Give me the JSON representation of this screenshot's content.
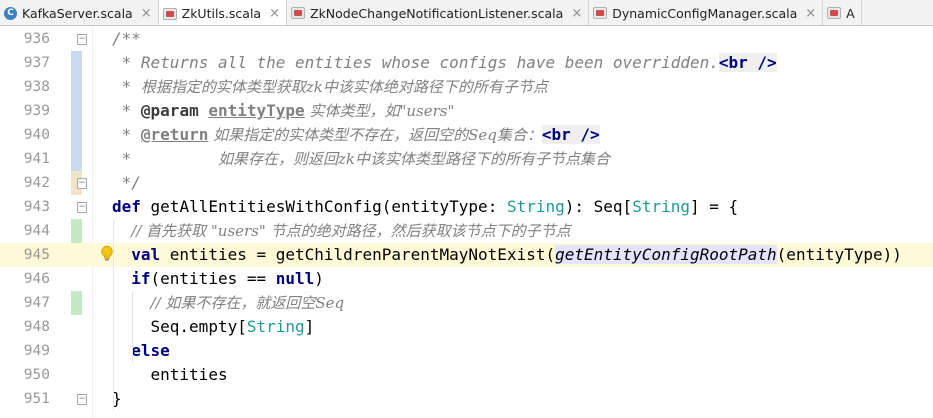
{
  "tabs": [
    {
      "label": "KafkaServer.scala",
      "icon": "class-icon",
      "icon_glyph": "C",
      "active": false
    },
    {
      "label": "ZkUtils.scala",
      "icon": "scala-file-icon",
      "icon_glyph": "",
      "active": true
    },
    {
      "label": "ZkNodeChangeNotificationListener.scala",
      "icon": "scala-file-icon",
      "icon_glyph": "",
      "active": false
    },
    {
      "label": "DynamicConfigManager.scala",
      "icon": "scala-file-icon",
      "icon_glyph": "",
      "active": false
    },
    {
      "label": "A",
      "icon": "scala-file-icon",
      "icon_glyph": "",
      "active": false
    }
  ],
  "close_glyph": "×",
  "line_numbers": [
    "936",
    "937",
    "938",
    "939",
    "940",
    "941",
    "942",
    "943",
    "944",
    "945",
    "946",
    "947",
    "948",
    "949",
    "950",
    "951"
  ],
  "code": {
    "l936": "/**",
    "l937_star": " * ",
    "l937_text": "Returns all the entities whose configs have been overridden.",
    "l937_tag": "<br />",
    "l938_star": " * ",
    "l938_text": "根据指定的实体类型获取zk中该实体绝对路径下的所有子节点",
    "l939_star": " * ",
    "l939_tag": "@param",
    "l939_param": "entityType",
    "l939_text": " 实体类型，如\"users\"",
    "l940_star": " * ",
    "l940_tag": "@return",
    "l940_text": " 如果指定的实体类型不存在，返回空的Seq集合：",
    "l940_br": "<br />",
    "l941_star": " *         ",
    "l941_text": "如果存在，则返回zk中该实体类型路径下的所有子节点集合",
    "l942": " */",
    "l943_def": "def",
    "l943_name": " getAllEntitiesWithConfig(entityType: ",
    "l943_type1": "String",
    "l943_mid": "): Seq[",
    "l943_type2": "String",
    "l943_end": "] = {",
    "l944": "// 首先获取 \"users\" 节点的绝对路径，然后获取该节点下的子节点",
    "l945_val": "val",
    "l945_mid": " entities = getChildrenParentMayNotExist(",
    "l945_fn": "getEntityConfigRootPath",
    "l945_end": "(entityType))",
    "l946_if": "if",
    "l946_mid": "(entities == ",
    "l946_null": "null",
    "l946_end": ")",
    "l947": "// 如果不存在，就返回空Seq",
    "l948_a": "Seq.empty[",
    "l948_type": "String",
    "l948_b": "]",
    "l949": "else",
    "l950": "entities",
    "l951": "}"
  },
  "colors": {
    "keyword": "#000080",
    "comment": "#808080",
    "type": "#20999d",
    "current_line": "#fefad8"
  }
}
